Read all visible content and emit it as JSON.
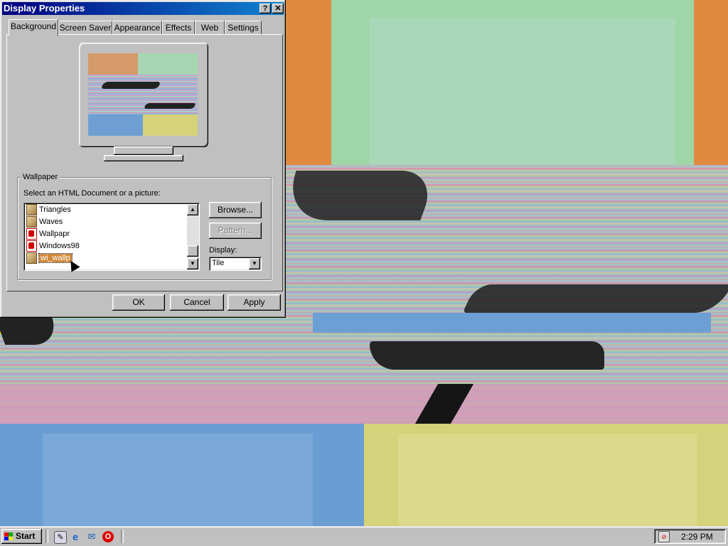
{
  "window": {
    "title": "Display Properties",
    "help_label": "?",
    "close_label": "✕"
  },
  "tabs": [
    {
      "label": "Background"
    },
    {
      "label": "Screen Saver"
    },
    {
      "label": "Appearance"
    },
    {
      "label": "Effects"
    },
    {
      "label": "Web"
    },
    {
      "label": "Settings"
    }
  ],
  "wallpaper": {
    "group_label": "Wallpaper",
    "instruction": "Select an HTML Document or a picture:",
    "items": [
      {
        "label": "Triangles",
        "icon": "html-document-icon"
      },
      {
        "label": "Waves",
        "icon": "html-document-icon"
      },
      {
        "label": "Wallpapr",
        "icon": "picture-icon"
      },
      {
        "label": "Windows98",
        "icon": "picture-icon"
      },
      {
        "label": "wi_wallp",
        "icon": "html-document-icon",
        "selected": true
      }
    ],
    "browse_label": "Browse...",
    "pattern_label": "Pattern...",
    "display_label": "Display:",
    "display_value": "Tile"
  },
  "buttons": {
    "ok": "OK",
    "cancel": "Cancel",
    "apply": "Apply"
  },
  "taskbar": {
    "start_label": "Start",
    "clock": "2:29 PM",
    "quick_launch": [
      "show-desktop-icon",
      "internet-explorer-icon",
      "outlook-express-icon",
      "opera-icon"
    ]
  },
  "colors": {
    "title_start": "#000080",
    "title_end": "#1084d0",
    "selection": "#d08a3a",
    "face": "#c0c0c0"
  }
}
